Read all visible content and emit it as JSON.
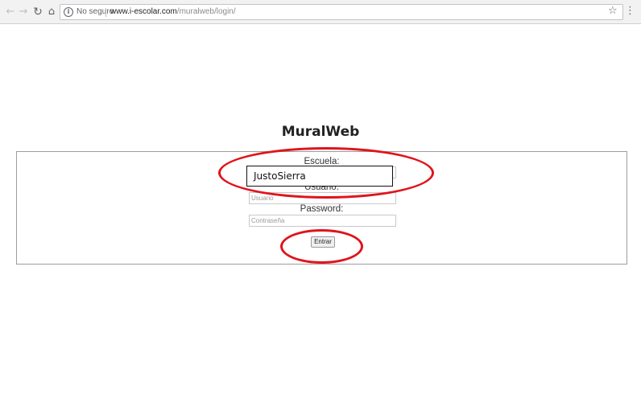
{
  "browser": {
    "security_label": "No seguro",
    "url_host": "www.i-escolar.com",
    "url_path": "/muralweb/login/",
    "icons": {
      "back": "arrow-left-icon",
      "forward": "arrow-right-icon",
      "reload": "reload-icon",
      "home": "home-icon",
      "info": "info-icon",
      "bookmark": "star-icon",
      "menu": "more-vert-icon"
    }
  },
  "page": {
    "title": "MuralWeb"
  },
  "form": {
    "school_label": "Escuela:",
    "user_label": "Usuario:",
    "user_placeholder": "Usuario",
    "password_label": "Password:",
    "password_placeholder": "Contraseña",
    "submit_label": "Entrar"
  },
  "annotation": {
    "school_value": "JustoSierra",
    "highlight_color": "#e0141b"
  }
}
